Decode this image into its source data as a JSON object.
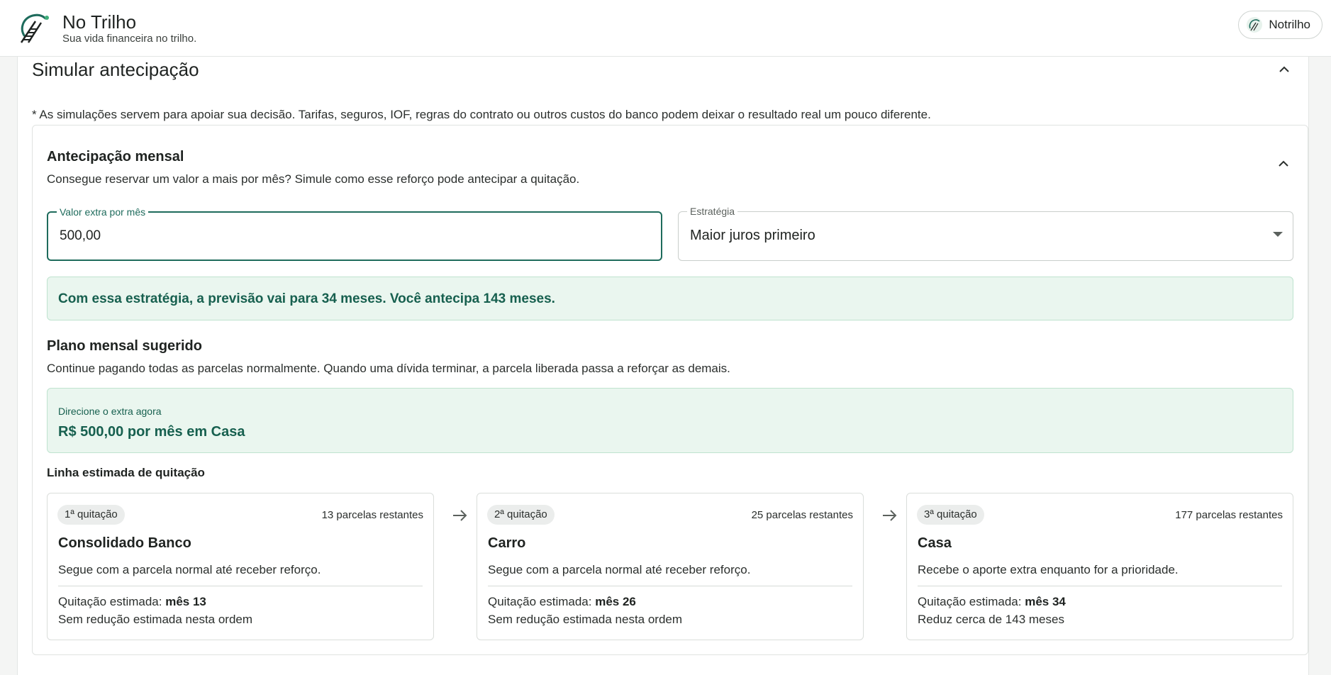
{
  "header": {
    "brand_name": "No Trilho",
    "tagline": "Sua vida financeira no trilho.",
    "user_label": "Notrilho"
  },
  "panel": {
    "title": "Simular antecipação",
    "disclaimer": "* As simulações servem para apoiar sua decisão. Tarifas, seguros, IOF, regras do contrato ou outros custos do banco podem deixar o resultado real um pouco diferente."
  },
  "monthly": {
    "title": "Antecipação mensal",
    "subtitle": "Consegue reservar um valor a mais por mês? Simule como esse reforço pode antecipar a quitação.",
    "extra_field": {
      "label": "Valor extra por mês",
      "value": "500,00"
    },
    "strategy_field": {
      "label": "Estratégia",
      "value": "Maior juros primeiro"
    },
    "result": "Com essa estratégia, a previsão vai para 34 meses. Você antecipa 143 meses."
  },
  "plan": {
    "title": "Plano mensal sugerido",
    "subtitle": "Continue pagando todas as parcelas normalmente. Quando uma dívida terminar, a parcela liberada passa a reforçar as demais.",
    "extra_label": "Direcione o extra agora",
    "extra_value": "R$ 500,00 por mês em Casa"
  },
  "timeline": {
    "title": "Linha estimada de quitação",
    "est_prefix": "Quitação estimada: ",
    "steps": [
      {
        "badge": "1ª quitação",
        "remaining": "13 parcelas restantes",
        "name": "Consolidado Banco",
        "desc": "Segue com a parcela normal até receber reforço.",
        "month": "mês 13",
        "reduction": "Sem redução estimada nesta ordem"
      },
      {
        "badge": "2ª quitação",
        "remaining": "25 parcelas restantes",
        "name": "Carro",
        "desc": "Segue com a parcela normal até receber reforço.",
        "month": "mês 26",
        "reduction": "Sem redução estimada nesta ordem"
      },
      {
        "badge": "3ª quitação",
        "remaining": "177 parcelas restantes",
        "name": "Casa",
        "desc": "Recebe o aporte extra enquanto for a prioridade.",
        "month": "mês 34",
        "reduction": "Reduz cerca de 143 meses"
      }
    ]
  },
  "colors": {
    "accent": "#1e6b5c",
    "success_bg": "#eaf6ef",
    "success_text": "#17604f"
  },
  "icons": [
    "rail-logo-icon",
    "chevron-up-icon",
    "arrow-right-icon",
    "dropdown-arrow-icon"
  ]
}
